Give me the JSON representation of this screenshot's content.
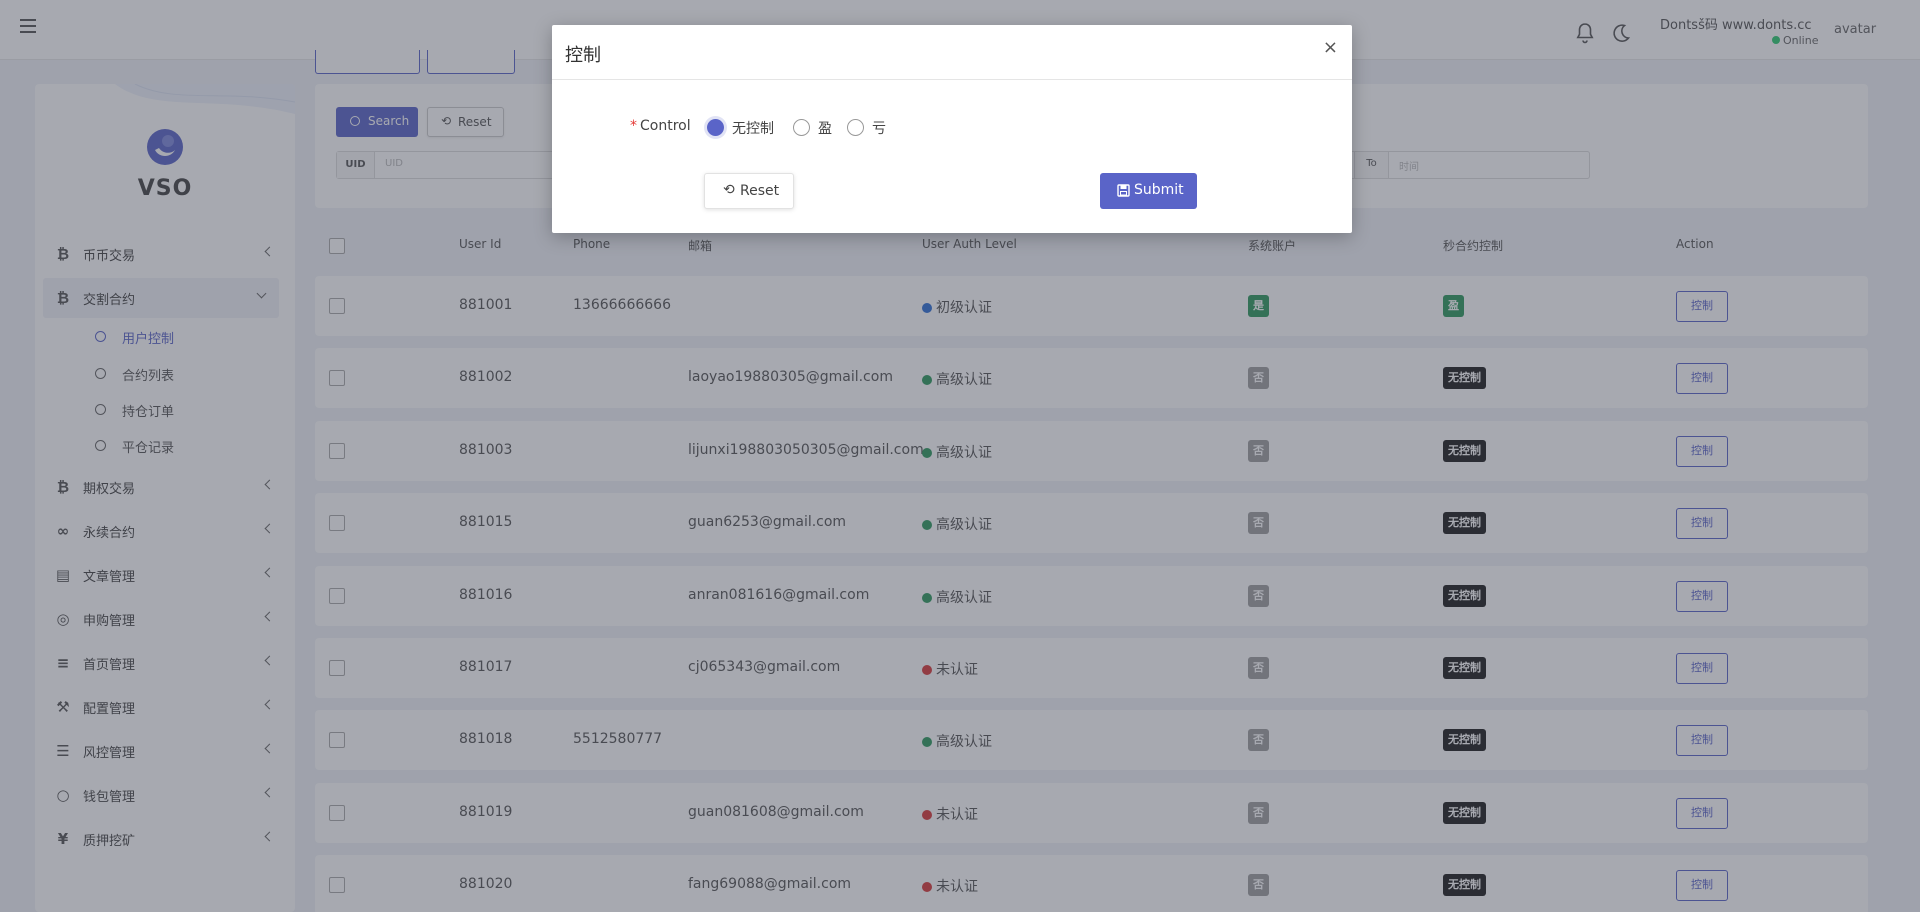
{
  "header": {
    "user_name": "Dontsš码 www.donts.cc",
    "status": "Online",
    "avatar_alt": "avatar"
  },
  "sidebar": {
    "brand": "VSO",
    "items": [
      {
        "icon": "bitcoin-icon",
        "label": "币币交易"
      },
      {
        "icon": "bitcoin-icon",
        "label": "交割合约"
      },
      {
        "icon": "bitcoin-icon",
        "label": "期权交易"
      },
      {
        "icon": "link-icon",
        "label": "永续合约"
      },
      {
        "icon": "article-icon",
        "label": "文章管理"
      },
      {
        "icon": "lifebuoy-icon",
        "label": "申购管理"
      },
      {
        "icon": "list-icon",
        "label": "首页管理"
      },
      {
        "icon": "wrench-icon",
        "label": "配置管理"
      },
      {
        "icon": "risk-list-icon",
        "label": "风控管理"
      },
      {
        "icon": "wallet-icon",
        "label": "钱包管理"
      },
      {
        "icon": "yen-icon",
        "label": "质押挖矿"
      }
    ],
    "subitems": [
      "用户控制",
      "合约列表",
      "持仓订单",
      "平仓记录"
    ]
  },
  "filters": {
    "search_label": "Search",
    "reset_label": "Reset",
    "uid_addon": "UID",
    "uid_placeholder": "UID",
    "to_addon": "To",
    "time_placeholder": "时间"
  },
  "table": {
    "headers": [
      "User Id",
      "Phone",
      "邮箱",
      "User Auth Level",
      "系统账户",
      "秒合约控制",
      "Action"
    ],
    "action_label": "控制",
    "rows": [
      {
        "id": "881001",
        "phone": "13666666666",
        "email": "",
        "auth": "初级认证",
        "auth_color": "#2f6fd6",
        "system": "是",
        "system_color": "#2e9a5e",
        "control": "盈",
        "control_color": "#2e9a5e"
      },
      {
        "id": "881002",
        "phone": "",
        "email": "laoyao19880305@gmail.com",
        "auth": "高级认证",
        "auth_color": "#2e9a5e",
        "system": "否",
        "system_color": "#9e9e9e",
        "control": "无控制",
        "control_color": "#1e1e1e"
      },
      {
        "id": "881003",
        "phone": "",
        "email": "lijunxi198803050305@gmail.com",
        "auth": "高级认证",
        "auth_color": "#2e9a5e",
        "system": "否",
        "system_color": "#9e9e9e",
        "control": "无控制",
        "control_color": "#1e1e1e"
      },
      {
        "id": "881015",
        "phone": "",
        "email": "guan6253@gmail.com",
        "auth": "高级认证",
        "auth_color": "#2e9a5e",
        "system": "否",
        "system_color": "#9e9e9e",
        "control": "无控制",
        "control_color": "#1e1e1e"
      },
      {
        "id": "881016",
        "phone": "",
        "email": "anran081616@gmail.com",
        "auth": "高级认证",
        "auth_color": "#2e9a5e",
        "system": "否",
        "system_color": "#9e9e9e",
        "control": "无控制",
        "control_color": "#1e1e1e"
      },
      {
        "id": "881017",
        "phone": "",
        "email": "cj065343@gmail.com",
        "auth": "未认证",
        "auth_color": "#d93a3a",
        "system": "否",
        "system_color": "#9e9e9e",
        "control": "无控制",
        "control_color": "#1e1e1e"
      },
      {
        "id": "881018",
        "phone": "5512580777",
        "email": "",
        "auth": "高级认证",
        "auth_color": "#2e9a5e",
        "system": "否",
        "system_color": "#9e9e9e",
        "control": "无控制",
        "control_color": "#1e1e1e"
      },
      {
        "id": "881019",
        "phone": "",
        "email": "guan081608@gmail.com",
        "auth": "未认证",
        "auth_color": "#d93a3a",
        "system": "否",
        "system_color": "#9e9e9e",
        "control": "无控制",
        "control_color": "#1e1e1e"
      },
      {
        "id": "881020",
        "phone": "",
        "email": "fang69088@gmail.com",
        "auth": "未认证",
        "auth_color": "#d93a3a",
        "system": "否",
        "system_color": "#9e9e9e",
        "control": "无控制",
        "control_color": "#1e1e1e"
      }
    ]
  },
  "modal": {
    "title": "控制",
    "close": "×",
    "field_label": "Control",
    "required_mark": "*",
    "options": [
      "无控制",
      "盈",
      "亏"
    ],
    "selected": "无控制",
    "reset_label": "Reset",
    "submit_label": "Submit"
  },
  "colors": {
    "accent": "#5a64c8",
    "online": "#2ecc71"
  }
}
